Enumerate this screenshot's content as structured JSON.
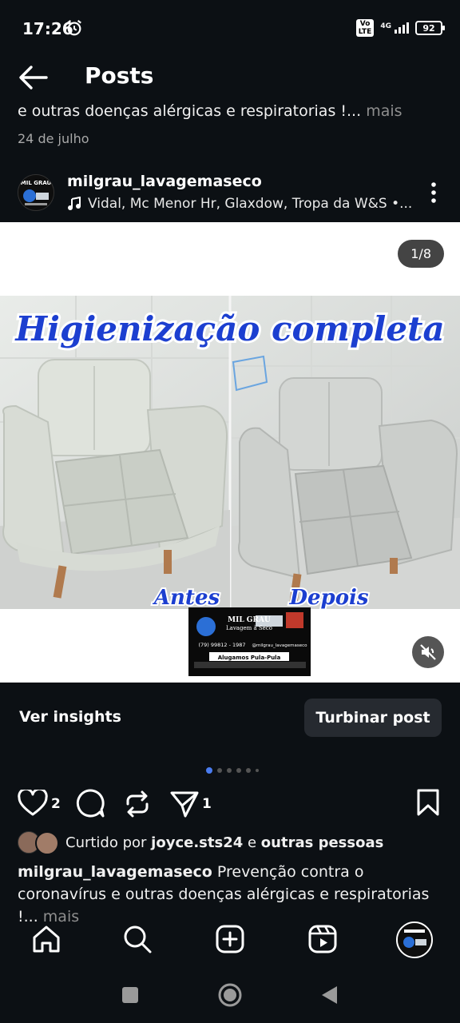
{
  "status_bar": {
    "time": "17:26",
    "network": "4G",
    "volte": "Vo\nLTE",
    "battery": "92"
  },
  "header": {
    "title": "Posts"
  },
  "previous_post": {
    "caption": "e outras doenças alérgicas e respiratorias !...",
    "more": "mais",
    "date": "24 de julho"
  },
  "post": {
    "username": "milgrau_lavagemaseco",
    "music": "Vidal, Mc Menor Hr, Glaxdow, Tropa da W&S •...",
    "counter": "1/8",
    "image_title": "Higienização completa",
    "label_before": "Antes",
    "label_after": "Depois",
    "logo": {
      "name": "MIL GRAU",
      "sub": "Lavagem à Seco",
      "phone": "(79) 99812 - 1987",
      "handle": "@milgrau_lavagemaseco",
      "rent": "Alugamos Pula-Pula"
    },
    "insights_label": "Ver insights",
    "boost_label": "Turbinar post",
    "like_count": "2",
    "share_count": "1",
    "liked_by": {
      "prefix": "Curtido por",
      "user": "joyce.sts24",
      "mid": "e",
      "others": "outras pessoas"
    },
    "caption_user": "milgrau_lavagemaseco",
    "caption_text": "Prevenção contra o coronavírus e outras doenças alérgicas e respiratorias !...",
    "caption_more": "mais",
    "carousel": {
      "total_dots": 6,
      "active_index": 0
    }
  },
  "colors": {
    "background": "#0c1014",
    "accent": "#4a7cf0",
    "title_blue": "#1c3fd0"
  },
  "icons": [
    "back-arrow-icon",
    "alarm-icon",
    "music-note-icon",
    "more-options-icon",
    "mute-icon",
    "heart-icon",
    "comment-icon",
    "repost-icon",
    "share-icon",
    "bookmark-icon",
    "home-icon",
    "search-icon",
    "create-icon",
    "reels-icon",
    "profile-icon"
  ]
}
